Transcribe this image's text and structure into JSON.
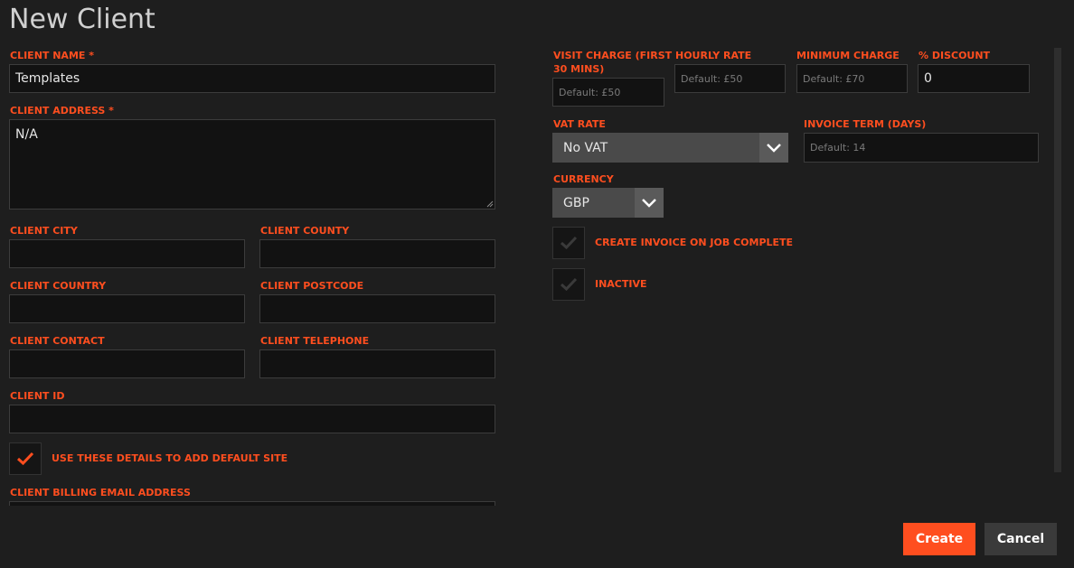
{
  "dialog": {
    "title": "New Client"
  },
  "left": {
    "client_name": {
      "label": "CLIENT NAME *",
      "value": "Templates"
    },
    "client_address": {
      "label": "CLIENT ADDRESS *",
      "value": "N/A"
    },
    "client_city": {
      "label": "CLIENT CITY",
      "value": ""
    },
    "client_county": {
      "label": "CLIENT COUNTY",
      "value": ""
    },
    "client_country": {
      "label": "CLIENT COUNTRY",
      "value": ""
    },
    "client_postcode": {
      "label": "CLIENT POSTCODE",
      "value": ""
    },
    "client_contact": {
      "label": "CLIENT CONTACT",
      "value": ""
    },
    "client_telephone": {
      "label": "CLIENT TELEPHONE",
      "value": ""
    },
    "client_id": {
      "label": "CLIENT ID",
      "value": ""
    },
    "default_site": {
      "label": "USE THESE DETAILS TO ADD DEFAULT SITE",
      "checked": true
    },
    "billing_email": {
      "label": "CLIENT BILLING EMAIL ADDRESS",
      "value": ""
    }
  },
  "right": {
    "visit_charge": {
      "label_line1": "VISIT CHARGE (FIRST",
      "label_line2": "30 MINS)",
      "placeholder": "Default: £50"
    },
    "hourly_rate": {
      "label": "HOURLY RATE",
      "placeholder": "Default: £50"
    },
    "minimum_charge": {
      "label": "MINIMUM CHARGE",
      "placeholder": "Default: £70"
    },
    "discount": {
      "label": "% DISCOUNT",
      "value": "0"
    },
    "vat_rate": {
      "label": "VAT RATE",
      "selected": "No VAT"
    },
    "invoice_term": {
      "label": "INVOICE TERM (DAYS)",
      "placeholder": "Default: 14"
    },
    "currency": {
      "label": "CURRENCY",
      "selected": "GBP"
    },
    "create_invoice": {
      "label": "CREATE INVOICE ON JOB COMPLETE",
      "checked": false
    },
    "inactive": {
      "label": "INACTIVE",
      "checked": false
    }
  },
  "actions": {
    "create": "Create",
    "cancel": "Cancel"
  },
  "colors": {
    "accent": "#ff4e1f",
    "background": "#1e1e1e",
    "input": "#121212"
  }
}
